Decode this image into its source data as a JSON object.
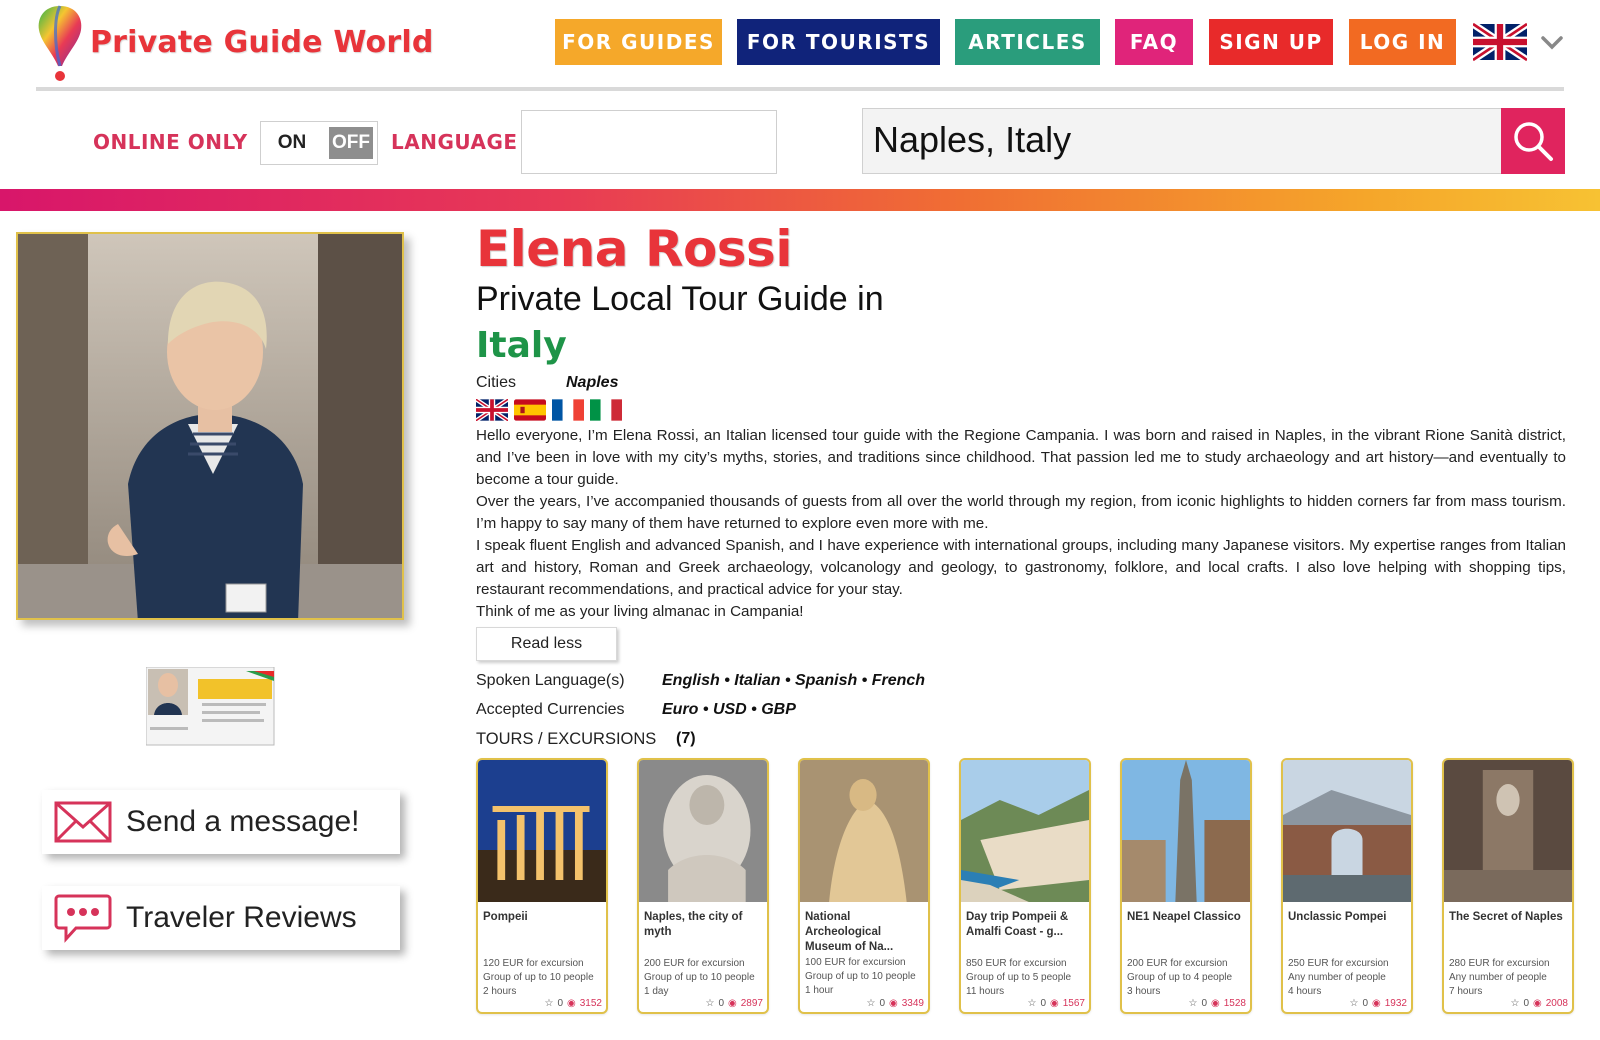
{
  "brand": {
    "name": "Private Guide World"
  },
  "nav": [
    {
      "label": "FOR GUIDES",
      "color": "#f5a82a"
    },
    {
      "label": "FOR TOURISTS",
      "color": "#10237a"
    },
    {
      "label": "ARTICLES",
      "color": "#2a9d7c"
    },
    {
      "label": "FAQ",
      "color": "#e0247a"
    },
    {
      "label": "SIGN UP",
      "color": "#e82a2a"
    },
    {
      "label": "LOG IN",
      "color": "#f26a22"
    }
  ],
  "filters": {
    "online_only_label": "ONLINE ONLY",
    "toggle_on": "ON",
    "toggle_off": "OFF",
    "language_label": "LANGUAGE",
    "language_value": "",
    "search_value": "Naples, Italy"
  },
  "profile": {
    "name": "Elena Rossi",
    "subtitle": "Private Local Tour Guide in",
    "country": "Italy",
    "cities_label": "Cities",
    "cities_value": "Naples",
    "bio": [
      "Hello everyone, I’m Elena Rossi, an Italian licensed tour guide with the Regione Campania. I was born and raised in Naples, in the vibrant Rione Sanità district, and I’ve been in love with my city’s myths, stories, and traditions since childhood. That passion led me to study archaeology and art history—and eventually to become a tour guide.",
      "Over the years, I’ve accompanied thousands of guests from all over the world through my region, from iconic highlights to hidden corners far from mass tourism. I’m happy to say many of them have returned to explore even more with me.",
      "I speak fluent English and advanced Spanish, and I have experience with international groups, including many Japanese visitors. My expertise ranges from Italian art and history, Roman and Greek archaeology, volcanology and geology, to gastronomy, folklore, and local crafts. I also love helping with shopping tips, restaurant recommendations, and practical advice for your stay.",
      "Think of me as your living almanac in Campania!"
    ],
    "read_less": "Read less",
    "languages_label": "Spoken Language(s)",
    "languages_value": "English • Italian • Spanish • French",
    "currencies_label": "Accepted Currencies",
    "currencies_value": "Euro • USD • GBP",
    "tours_label": "TOURS / EXCURSIONS",
    "tours_count": "(7)"
  },
  "actions": {
    "message": "Send a message!",
    "reviews": "Traveler Reviews"
  },
  "tours": [
    {
      "title": "Pompeii",
      "price": "120 EUR for excursion",
      "group": "Group of up to 10 people",
      "duration": "2 hours",
      "stars": "0",
      "views": "3152"
    },
    {
      "title": "Naples, the city of myth",
      "price": "200 EUR for excursion",
      "group": "Group of up to 10 people",
      "duration": "1 day",
      "stars": "0",
      "views": "2897"
    },
    {
      "title": "National Archeological Museum of Na...",
      "price": "100 EUR for excursion",
      "group": "Group of up to 10 people",
      "duration": "1 hour",
      "stars": "0",
      "views": "3349"
    },
    {
      "title": "Day trip Pompeii & Amalfi Coast - g...",
      "price": "850 EUR for excursion",
      "group": "Group of up to 5 people",
      "duration": "11 hours",
      "stars": "0",
      "views": "1567"
    },
    {
      "title": "NE1 Neapel Classico",
      "price": "200 EUR for excursion",
      "group": "Group of up to 4 people",
      "duration": "3 hours",
      "stars": "0",
      "views": "1528"
    },
    {
      "title": "Unclassic Pompei",
      "price": "250 EUR for excursion",
      "group": "Any number of people",
      "duration": "4 hours",
      "stars": "0",
      "views": "1932"
    },
    {
      "title": "The Secret of Naples",
      "price": "280 EUR for excursion",
      "group": "Any number of people",
      "duration": "7 hours",
      "stars": "0",
      "views": "2008"
    }
  ]
}
